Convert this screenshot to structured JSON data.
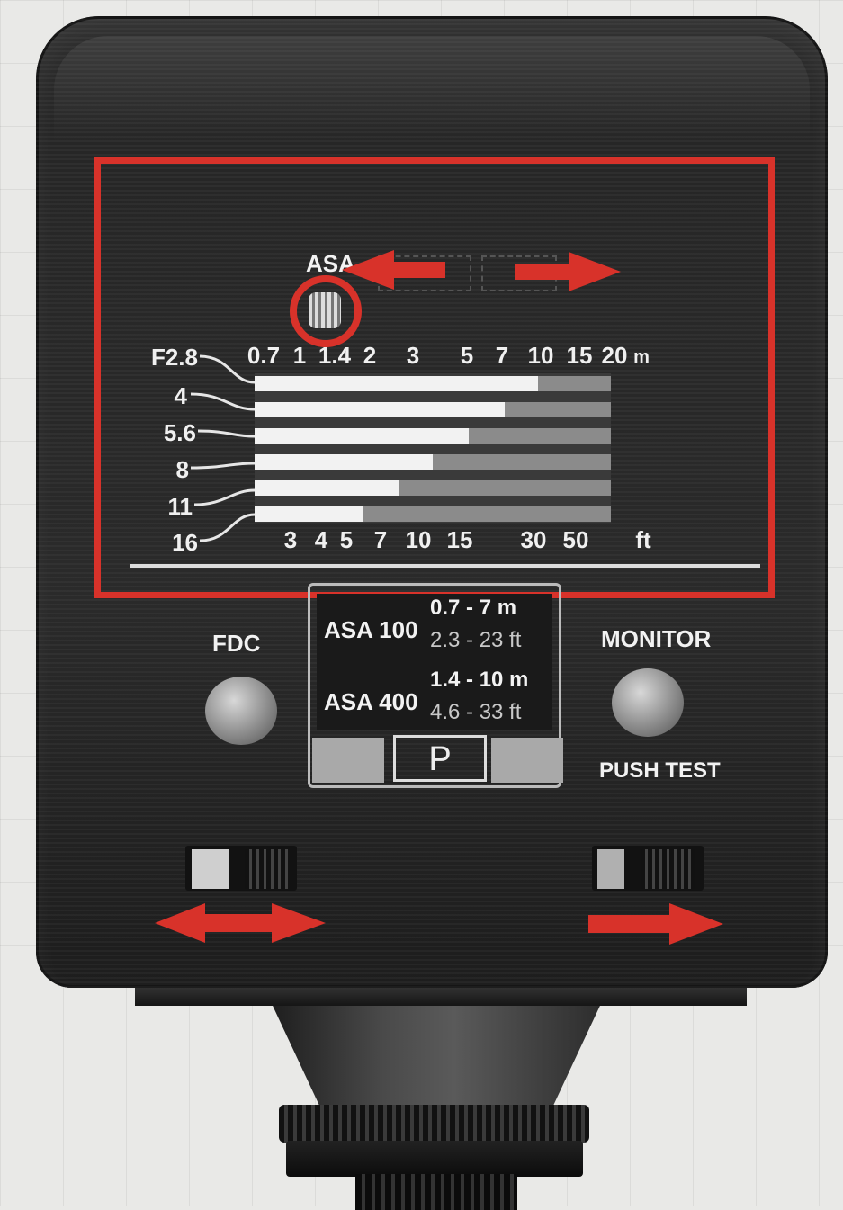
{
  "top_dial": {
    "asa_label": "ASA"
  },
  "distance_scale_m": {
    "values": [
      "0.7",
      "1",
      "1.4",
      "2",
      "3",
      "5",
      "7",
      "10",
      "15",
      "20"
    ],
    "unit": "m"
  },
  "distance_scale_ft": {
    "values": [
      "3",
      "4",
      "5",
      "7",
      "10",
      "15",
      "30",
      "50"
    ],
    "unit": "ft"
  },
  "aperture_stops": [
    "F2.8",
    "4",
    "5.6",
    "8",
    "11",
    "16"
  ],
  "auto_range_panel": {
    "rows": [
      {
        "asa": "ASA 100",
        "range_m": "0.7 - 7 m",
        "range_ft": "2.3 - 23 ft"
      },
      {
        "asa": "ASA 400",
        "range_m": "1.4 - 10 m",
        "range_ft": "4.6 - 33 ft"
      }
    ],
    "mode_label": "P"
  },
  "controls": {
    "fdc_label": "FDC",
    "monitor_label": "MONITOR",
    "push_test_label": "PUSH TEST"
  },
  "colors": {
    "highlight": "#d8322a",
    "body": "#262626",
    "scale_text": "#f0f0f0"
  }
}
